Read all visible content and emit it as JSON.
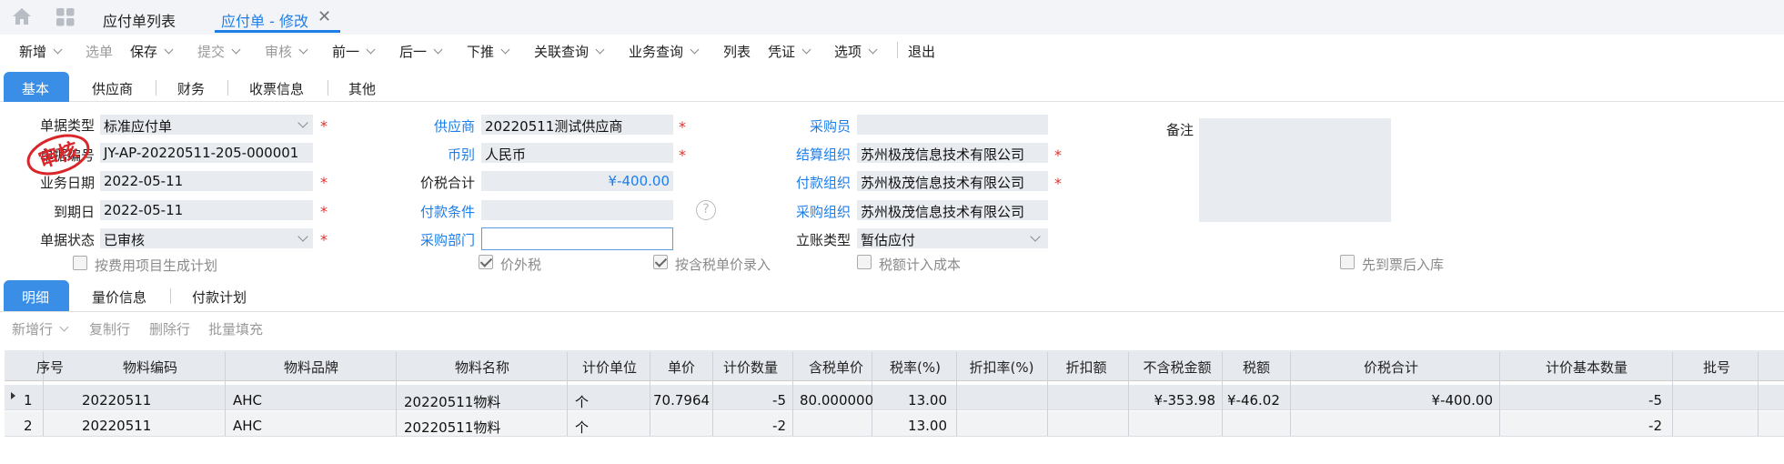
{
  "tabs_top": {
    "list": "应付单列表",
    "active": "应付单 - 修改",
    "close": "✕"
  },
  "toolbar": {
    "new": "新增",
    "select": "选单",
    "save": "保存",
    "submit": "提交",
    "audit": "审核",
    "prev": "前一",
    "next": "后一",
    "push": "下推",
    "related": "关联查询",
    "biz": "业务查询",
    "list": "列表",
    "voucher": "凭证",
    "options": "选项",
    "exit": "退出"
  },
  "tabs2": {
    "basic": "基本",
    "supplier": "供应商",
    "finance": "财务",
    "invoice": "收票信息",
    "other": "其他"
  },
  "form": {
    "doc_type_label": "单据类型",
    "doc_type": "标准应付单",
    "doc_no_label": "单据编号",
    "doc_no": "JY-AP-20220511-205-000001",
    "biz_date_label": "业务日期",
    "biz_date": "2022-05-11",
    "due_date_label": "到期日",
    "due_date": "2022-05-11",
    "status_label": "单据状态",
    "status": "已审核",
    "supplier_label": "供应商",
    "supplier": "20220511测试供应商",
    "currency_label": "币别",
    "currency": "人民币",
    "total_label": "价税合计",
    "total": "¥-400.00",
    "pay_cond_label": "付款条件",
    "pay_cond": "",
    "purchase_dept_label": "采购部门",
    "purchase_dept": "",
    "buyer_label": "采购员",
    "buyer": "",
    "settle_org_label": "结算组织",
    "settle_org": "苏州极茂信息技术有限公司",
    "pay_org_label": "付款组织",
    "pay_org": "苏州极茂信息技术有限公司",
    "purchase_org_label": "采购组织",
    "purchase_org": "苏州极茂信息技术有限公司",
    "account_type_label": "立账类型",
    "account_type": "暂估应付",
    "remark_label": "备注",
    "help": "?",
    "stamp": "审核"
  },
  "checks": {
    "c1": "按费用项目生成计划",
    "c2": "价外税",
    "c3": "按含税单价录入",
    "c4": "税额计入成本",
    "c5": "先到票后入库"
  },
  "subtabs": {
    "detail": "明细",
    "price": "量价信息",
    "plan": "付款计划"
  },
  "gridtb": {
    "add": "新增行",
    "copy": "复制行",
    "del": "删除行",
    "fill": "批量填充"
  },
  "columns": [
    "序号",
    "物料编码",
    "物料品牌",
    "物料名称",
    "计价单位",
    "单价",
    "计价数量",
    "含税单价",
    "税率(%)",
    "折扣率(%)",
    "折扣额",
    "不含税金额",
    "税额",
    "价税合计",
    "计价基本数量",
    "批号"
  ],
  "rows": [
    {
      "no": "1",
      "code": "20220511",
      "brand": "AHC",
      "name": "20220511物料",
      "unit": "个",
      "price": "70.7964",
      "qty": "-5",
      "taxprice": "80.000000",
      "rate": "13.00",
      "disc": "",
      "discamt": "",
      "net": "¥-353.98",
      "tax": "¥-46.02",
      "total": "¥-400.00",
      "baseqty": "-5",
      "lot": ""
    },
    {
      "no": "2",
      "code": "20220511",
      "brand": "AHC",
      "name": "20220511物料",
      "unit": "个",
      "price": "",
      "qty": "-2",
      "taxprice": "",
      "rate": "13.00",
      "disc": "",
      "discamt": "",
      "net": "",
      "tax": "",
      "total": "",
      "baseqty": "-2",
      "lot": ""
    }
  ]
}
